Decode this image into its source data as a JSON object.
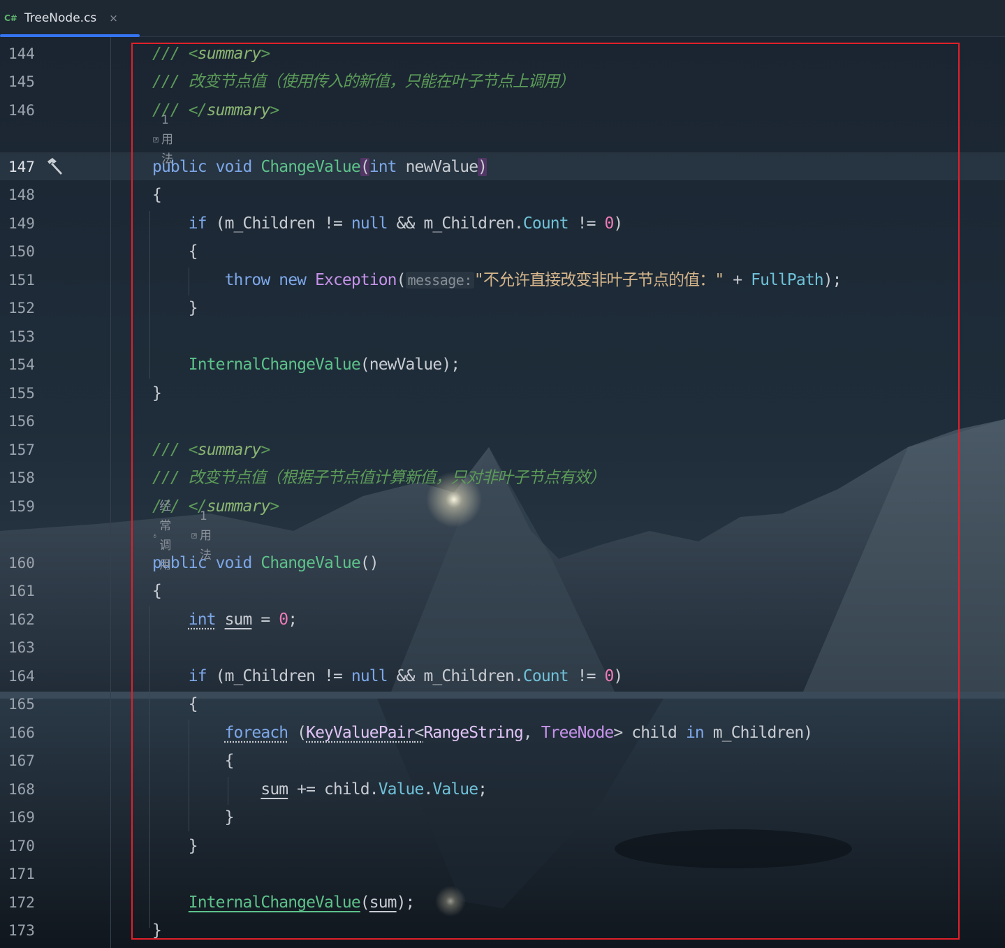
{
  "tab": {
    "lang_badge": "C#",
    "file_name": "TreeNode.cs",
    "close_glyph": "×",
    "accent_color": "#3574f0"
  },
  "gutter": {
    "line_numbers": [
      "144",
      "145",
      "146",
      "147",
      "148",
      "149",
      "150",
      "151",
      "152",
      "153",
      "154",
      "155",
      "156",
      "157",
      "158",
      "159",
      "160",
      "161",
      "162",
      "163",
      "164",
      "165",
      "166",
      "167",
      "168",
      "169",
      "170",
      "171",
      "172",
      "173"
    ],
    "current_line": "147",
    "gutter_icon": "hammer-icon"
  },
  "lens": {
    "usages_1": "1 用法",
    "frequent": "经常调用",
    "usages_2": "1 用法"
  },
  "code": {
    "l144": {
      "slashes": "/// ",
      "open": "<",
      "tag": "summary",
      "close": ">"
    },
    "l145": {
      "text": "/// 改变节点值（使用传入的新值，只能在叶子节点上调用）"
    },
    "l146": {
      "slashes": "/// ",
      "open": "</",
      "tag": "summary",
      "close": ">"
    },
    "l147": {
      "kw1": "public",
      "kw2": "void",
      "fn": "ChangeValue",
      "lp": "(",
      "type": "int",
      "param": "newValue",
      "rp": ")"
    },
    "l148": {
      "text": "{"
    },
    "l149": {
      "kw": "if",
      "p1": " (",
      "id1": "m_Children",
      "op1": " != ",
      "kw_null": "null",
      "op2": " && ",
      "id2": "m_Children",
      "dot": ".",
      "prop": "Count",
      "op3": " != ",
      "num": "0",
      "p2": ")"
    },
    "l150": {
      "text": "{"
    },
    "l151": {
      "kw1": "throw",
      "kw2": "new",
      "ty": "Exception",
      "lp": "(",
      "hint": "message:",
      "str": "\"不允许直接改变非叶子节点的值：\"",
      "plus": " + ",
      "prop": "FullPath",
      "end": ");"
    },
    "l152": {
      "text": "}"
    },
    "l154": {
      "fn": "InternalChangeValue",
      "args": "(newValue);"
    },
    "l155": {
      "text": "}"
    },
    "l157": {
      "slashes": "/// ",
      "open": "<",
      "tag": "summary",
      "close": ">"
    },
    "l158": {
      "text": "/// 改变节点值（根据子节点值计算新值，只对非叶子节点有效）"
    },
    "l159": {
      "slashes": "/// ",
      "open": "</",
      "tag": "summary",
      "close": ">"
    },
    "l160": {
      "kw1": "public",
      "kw2": "void",
      "fn": "ChangeValue",
      "args": "()"
    },
    "l161": {
      "text": "{"
    },
    "l162": {
      "kw": "int",
      "var": "sum",
      "op": " = ",
      "num": "0",
      "end": ";"
    },
    "l164": {
      "kw": "if",
      "p1": " (",
      "id1": "m_Children",
      "op1": " != ",
      "kw_null": "null",
      "op2": " && ",
      "id2": "m_Children",
      "dot": ".",
      "prop": "Count",
      "op3": " != ",
      "num": "0",
      "p2": ")"
    },
    "l165": {
      "text": "{"
    },
    "l166": {
      "kw": "foreach",
      "p1": " (",
      "ty1": "KeyValuePair",
      "lt": "<",
      "ty2": "RangeString",
      "comma": ", ",
      "ty3": "TreeNode",
      "gt": ">",
      "var": " child ",
      "kw_in": "in",
      "id": " m_Children",
      "p2": ")"
    },
    "l167": {
      "text": "{"
    },
    "l168": {
      "var": "sum",
      "op": " += child",
      "dot1": ".",
      "prop1": "Value",
      "dot2": ".",
      "prop2": "Value",
      "end": ";"
    },
    "l169": {
      "text": "}"
    },
    "l170": {
      "text": "}"
    },
    "l172": {
      "fn": "InternalChangeValue",
      "lp": "(",
      "var": "sum",
      "end": ");"
    },
    "l173": {
      "text": "}"
    }
  },
  "highlight_box_color": "#e0202a"
}
